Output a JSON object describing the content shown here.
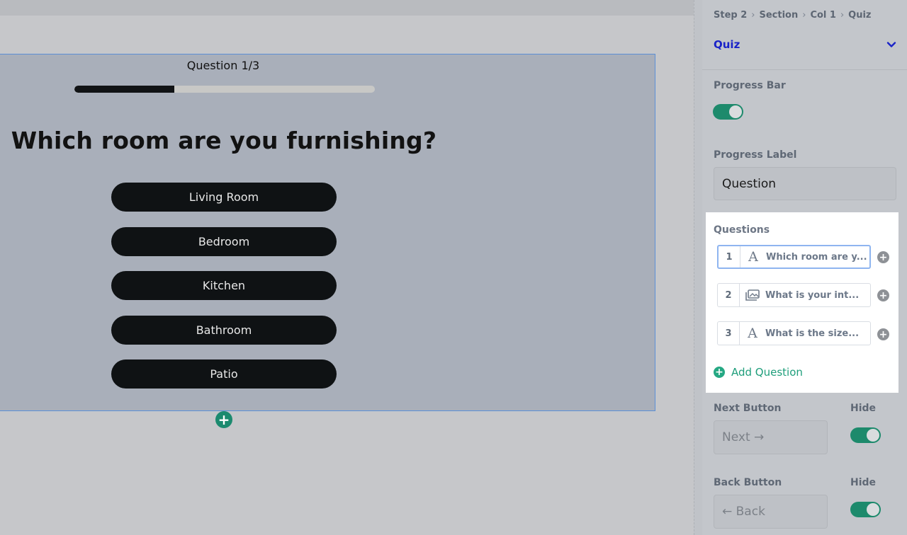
{
  "canvas": {
    "progress_label": "Question 1/3",
    "progress_fraction": 0.333,
    "question_title": "Which room are you furnishing?",
    "answers": [
      "Living Room",
      "Bedroom",
      "Kitchen",
      "Bathroom",
      "Patio"
    ],
    "add_block_symbol": "+"
  },
  "sidebar": {
    "breadcrumb": [
      "Step 2",
      "Section",
      "Col 1",
      "Quiz"
    ],
    "breadcrumb_sep": "›",
    "section_title": "Quiz",
    "progress_bar_label": "Progress Bar",
    "progress_bar_on": true,
    "progress_label_label": "Progress Label",
    "progress_label_value": "Question",
    "questions_title": "Questions",
    "questions": [
      {
        "num": "1",
        "icon": "text-icon",
        "glyph": "A",
        "text": "Which room are y..."
      },
      {
        "num": "2",
        "icon": "image-icon",
        "glyph": "🖾",
        "text": "What is your int..."
      },
      {
        "num": "3",
        "icon": "text-icon",
        "glyph": "A",
        "text": "What is the size..."
      }
    ],
    "add_question_label": "Add Question",
    "next_button_label": "Next Button",
    "next_button_value": "Next →",
    "back_button_label": "Back Button",
    "back_button_value": "← Back",
    "hide_label": "Hide"
  },
  "colors": {
    "accent_green": "#1d8a6c",
    "link_blue": "#1a23c8",
    "button_dark": "#0f1214"
  }
}
